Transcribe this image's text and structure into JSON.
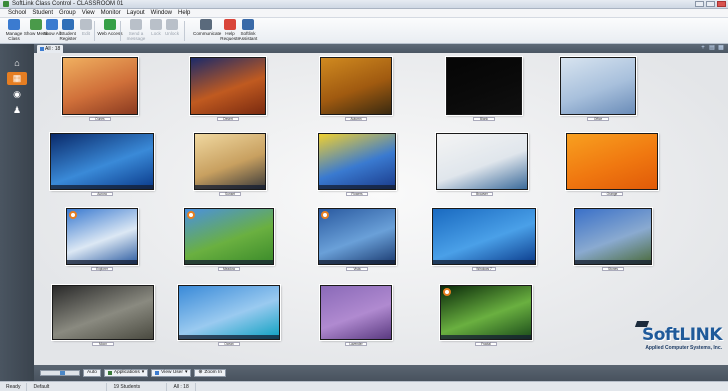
{
  "window": {
    "title": "SoftLink Class Control - CLASSROOM 01"
  },
  "menu": [
    "School",
    "Student",
    "Group",
    "View",
    "Monitor",
    "Layout",
    "Window",
    "Help"
  ],
  "toolbar": {
    "buttons": [
      {
        "label": "Manage Class",
        "icon": "manage-class-icon",
        "color": "#3b7bd0",
        "enabled": true
      },
      {
        "label": "Show Menu",
        "icon": "show-menu-icon",
        "color": "#4a9a4a",
        "enabled": true
      },
      {
        "label": "Show All",
        "icon": "show-all-icon",
        "color": "#3b7bd0",
        "enabled": true
      },
      {
        "label": "Student Register",
        "icon": "student-register-icon",
        "color": "#2f6fb8",
        "enabled": true
      },
      {
        "label": "Edit",
        "icon": "edit-icon",
        "color": "#b9c0c9",
        "enabled": false
      },
      {
        "label": "Web Access",
        "icon": "web-access-icon",
        "color": "#37a047",
        "enabled": true
      },
      {
        "label": "Send a message",
        "icon": "send-message-icon",
        "color": "#b9c0c9",
        "enabled": false
      },
      {
        "label": "Lock",
        "icon": "lock-icon",
        "color": "#b9c0c9",
        "enabled": false
      },
      {
        "label": "Unlock",
        "icon": "unlock-icon",
        "color": "#b9c0c9",
        "enabled": false
      },
      {
        "label": "Communicate",
        "icon": "communicate-icon",
        "color": "#5a6a7c",
        "enabled": true
      },
      {
        "label": "Help Requests",
        "icon": "help-requests-icon",
        "color": "#d9453a",
        "enabled": true
      },
      {
        "label": "Softlink Assistant",
        "icon": "assistant-icon",
        "color": "#3a6aa8",
        "enabled": true
      }
    ]
  },
  "tab": {
    "label": "All : 18"
  },
  "students": [
    {
      "name": "Dunes",
      "colors": [
        "#f0b060",
        "#d0703a",
        "#8a3a20"
      ],
      "taskbar": false
    },
    {
      "name": "Desert",
      "colors": [
        "#1b2a6a",
        "#c05a20",
        "#7a2a10"
      ],
      "taskbar": false
    },
    {
      "name": "Autumn",
      "colors": [
        "#d08a20",
        "#a05a10",
        "#3a2a10"
      ],
      "taskbar": false
    },
    {
      "name": "Blank",
      "colors": [
        "#050505",
        "#0a0a0a",
        "#101010"
      ],
      "taskbar": false
    },
    {
      "name": "Office",
      "colors": [
        "#d8e4f0",
        "#a8c0dc",
        "#6a8cb8"
      ],
      "taskbar": false
    },
    {
      "name": "Aurora",
      "colors": [
        "#0a2a6a",
        "#3a8ad8",
        "#0a3a8a"
      ],
      "taskbar": true
    },
    {
      "name": "Sunset",
      "colors": [
        "#f0d8a0",
        "#c8a060",
        "#3a3a3a"
      ],
      "taskbar": true
    },
    {
      "name": "Flowers",
      "colors": [
        "#f0d030",
        "#3a7ad0",
        "#1a3a8a"
      ],
      "taskbar": true
    },
    {
      "name": "Browser",
      "colors": [
        "#f4f4f4",
        "#e0e6ec",
        "#3a6a9a"
      ],
      "taskbar": false
    },
    {
      "name": "Orange",
      "colors": [
        "#f8a020",
        "#f07810",
        "#e05a08"
      ],
      "taskbar": false
    },
    {
      "name": "Explorer",
      "colors": [
        "#3a7ad0",
        "#dce8f4",
        "#2a5aa0"
      ],
      "taskbar": true
    },
    {
      "name": "Meadow",
      "colors": [
        "#4a90e0",
        "#6ab040",
        "#3a8a2a"
      ],
      "taskbar": true
    },
    {
      "name": "Vista",
      "colors": [
        "#2a5aa0",
        "#6aa0d8",
        "#1a3a70"
      ],
      "taskbar": true
    },
    {
      "name": "Windows 7",
      "colors": [
        "#1a6ac0",
        "#4aa0e8",
        "#0a3a8a"
      ],
      "taskbar": true
    },
    {
      "name": "Stones",
      "colors": [
        "#3a70c8",
        "#8aaad0",
        "#4a6a3a"
      ],
      "taskbar": true
    },
    {
      "name": "Moon",
      "colors": [
        "#2a2a2a",
        "#8a8a80",
        "#4a4a40"
      ],
      "taskbar": false
    },
    {
      "name": "Ocean",
      "colors": [
        "#3a8ad8",
        "#9acaf0",
        "#0aa0c0"
      ],
      "taskbar": true
    },
    {
      "name": "Lavender",
      "colors": [
        "#8a6ab8",
        "#b08ad0",
        "#5a3a80"
      ],
      "taskbar": false
    },
    {
      "name": "Fractal",
      "colors": [
        "#0a2a0a",
        "#6ab040",
        "#1a4a1a"
      ],
      "taskbar": true
    }
  ],
  "bottom": {
    "auto_label": "Auto",
    "applications_label": "Applications",
    "view_user_label": "View User",
    "zoom_label": "Zoom In",
    "zoom_level": 0.55
  },
  "logo": {
    "text": "SoftLINK",
    "subtitle": "Applied Computer Systems, Inc."
  },
  "status": {
    "state": "Ready",
    "group": "Default",
    "students": "19 Students",
    "count": "All : 18"
  }
}
